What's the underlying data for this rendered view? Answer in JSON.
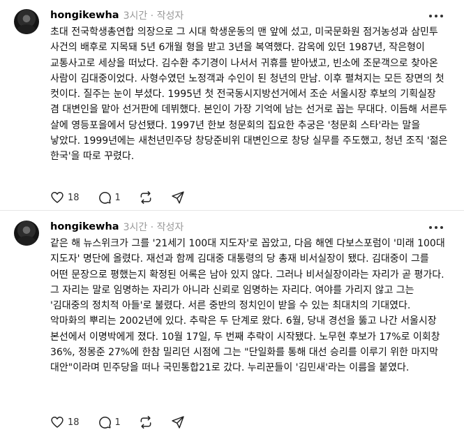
{
  "posts": [
    {
      "username": "hongikewha",
      "time": "3시간",
      "author_tag": "작성자",
      "body": "초대 전국학생총연합 의장으로 그 시대 학생운동의 맨 앞에 섰고, 미국문화원 점거농성과 삼민투 사건의 배후로 지목돼 5년 6개월 형을 받고 3년을 복역했다. 감옥에 있던 1987년, 작은형이 교통사고로 세상을 떠났다. 김수환 추기경이 나서서 귀휴를 받아냈고, 빈소에 조문객으로 찾아온 사람이 김대중이었다. 사형수였던 노정객과 수인이 된 청년의 만남. 이후 펼쳐지는 모든 장면의 첫 컷이다. 질주는 눈이 부셨다. 1995년 첫 전국동시지방선거에서 조순 서울시장 후보의 기획실장 겸 대변인을 맡아 선거판에 데뷔했다. 본인이 가장 기억에 남는 선거로 꼽는 무대다. 이듬해 서른두 살에 영등포을에서 당선됐다. 1997년 한보 청문회의 집요한 추궁은 '청문회 스타'라는 말을 낳았다. 1999년에는 새천년민주당 창당준비위 대변인으로 창당 실무를 주도했고, 청년 조직 '젊은 한국'을 따로 꾸렸다.",
      "likes": "18",
      "replies": "1"
    },
    {
      "username": "hongikewha",
      "time": "3시간",
      "author_tag": "작성자",
      "body": "같은 해 뉴스위크가 그를 '21세기 100대 지도자'로 꼽았고, 다음 해엔 다보스포럼이 '미래 100대 지도자' 명단에 올렸다. 재선과 함께 김대중 대통령의 당 총재 비서실장이 됐다. 김대중이 그를 어떤 문장으로 평했는지 확정된 어록은 남아 있지 않다. 그러나 비서실장이라는 자리가 곧 평가다. 그 자리는 말로 임명하는 자리가 아니라 신뢰로 임명하는 자리다. 여야를 가리지 않고 그는 '김대중의 정치적 아들'로 불렸다. 서른 중반의 정치인이 받을 수 있는 최대치의 기대였다. 악마화의 뿌리는 2002년에 있다. 추락은 두 단계로 왔다. 6월, 당내 경선을 뚫고 나간 서울시장 본선에서 이명박에게 졌다. 10월 17일, 두 번째 추락이 시작됐다. 노무현 후보가 17%로 이회창 36%, 정몽준 27%에 한참 밀리던 시점에 그는 \"단일화를 통해 대선 승리를 이루기 위한 마지막 대안\"이라며 민주당을 떠나 국민통합21로 갔다. 누리꾼들이 '김민새'라는 이름을 붙였다.",
      "likes": "18",
      "replies": "1"
    }
  ],
  "icons": {
    "like": "heart-icon",
    "reply": "comment-icon",
    "repost": "repost-icon",
    "share": "send-icon",
    "more": "more-icon"
  },
  "colors": {
    "meta": "#999999",
    "text": "#101010"
  }
}
